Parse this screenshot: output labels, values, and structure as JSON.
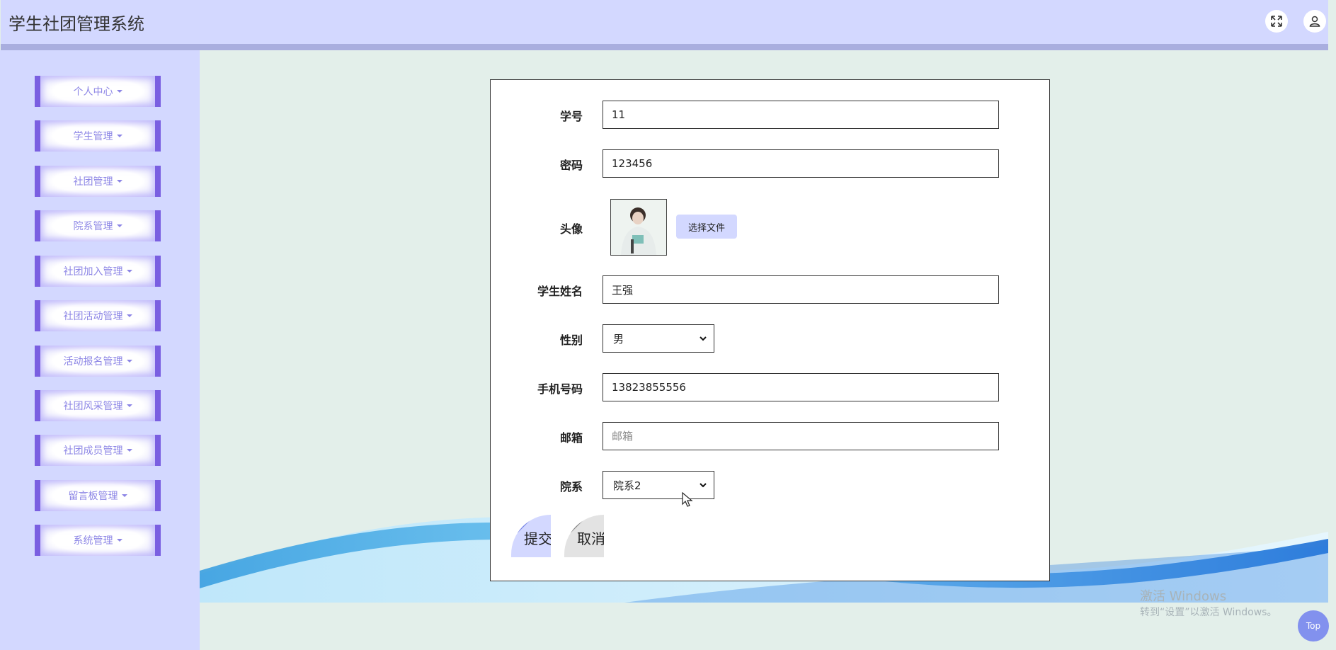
{
  "app_title": "学生社团管理系统",
  "header": {
    "fullscreen_icon": "expand-icon",
    "user_icon": "user-icon"
  },
  "sidebar": {
    "items": [
      {
        "label": "个人中心"
      },
      {
        "label": "学生管理"
      },
      {
        "label": "社团管理"
      },
      {
        "label": "院系管理"
      },
      {
        "label": "社团加入管理"
      },
      {
        "label": "社团活动管理"
      },
      {
        "label": "活动报名管理"
      },
      {
        "label": "社团风采管理"
      },
      {
        "label": "社团成员管理"
      },
      {
        "label": "留言板管理"
      },
      {
        "label": "系统管理"
      }
    ]
  },
  "form": {
    "student_id": {
      "label": "学号",
      "value": "11"
    },
    "password": {
      "label": "密码",
      "value": "123456"
    },
    "avatar": {
      "label": "头像",
      "button": "选择文件"
    },
    "name": {
      "label": "学生姓名",
      "value": "王强"
    },
    "gender": {
      "label": "性别",
      "value": "男"
    },
    "phone": {
      "label": "手机号码",
      "value": "13823855556"
    },
    "email": {
      "label": "邮箱",
      "value": "",
      "placeholder": "邮箱"
    },
    "department": {
      "label": "院系",
      "value": "院系2"
    },
    "submit_label": "提交",
    "cancel_label": "取消"
  },
  "watermark": {
    "line1": "激活 Windows",
    "line2": "转到“设置”以激活 Windows。"
  },
  "top_button": "Top",
  "colors": {
    "header": "#d3d8ff",
    "accent": "#7a5fe1",
    "page_bg": "#e3efea"
  }
}
